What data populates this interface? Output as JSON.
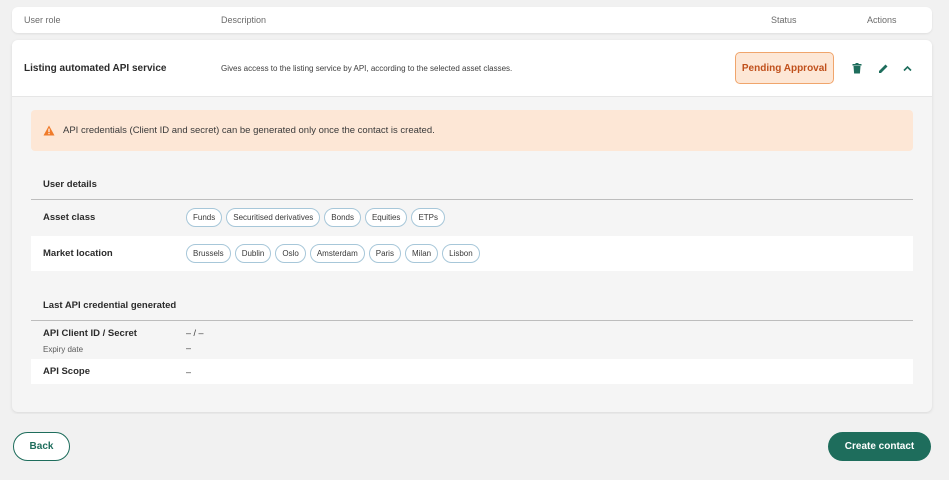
{
  "table_header": {
    "user_role": "User role",
    "description": "Description",
    "status": "Status",
    "actions": "Actions"
  },
  "row": {
    "role_name": "Listing automated API service",
    "description": "Gives access to the listing service by API, according to the selected asset classes.",
    "status": "Pending Approval",
    "actions": [
      {
        "icon": "trash-icon"
      },
      {
        "icon": "pencil-icon"
      },
      {
        "icon": "chevron-up-icon"
      }
    ]
  },
  "alert": {
    "icon": "warning-icon",
    "text": "API credentials (Client ID and secret) can be generated only once the contact is created."
  },
  "user_details": {
    "title": "User details",
    "asset_class_label": "Asset class",
    "asset_classes": [
      "Funds",
      "Securitised derivatives",
      "Bonds",
      "Equities",
      "ETPs"
    ],
    "market_location_label": "Market location",
    "market_locations": [
      "Brussels",
      "Dublin",
      "Oslo",
      "Amsterdam",
      "Paris",
      "Milan",
      "Lisbon"
    ]
  },
  "credentials": {
    "title": "Last API credential generated",
    "client_label": "API Client ID / Secret",
    "client_value": "– / –",
    "expiry_label": "Expiry date",
    "expiry_value": "–",
    "scope_label": "API Scope",
    "scope_value": "–"
  },
  "footer": {
    "back_label": "Back",
    "create_label": "Create contact"
  },
  "colors": {
    "primary": "#1e6d5c",
    "pending_bg": "#fde7d6",
    "pending_text": "#c0501c",
    "warning": "#f07b2a"
  }
}
